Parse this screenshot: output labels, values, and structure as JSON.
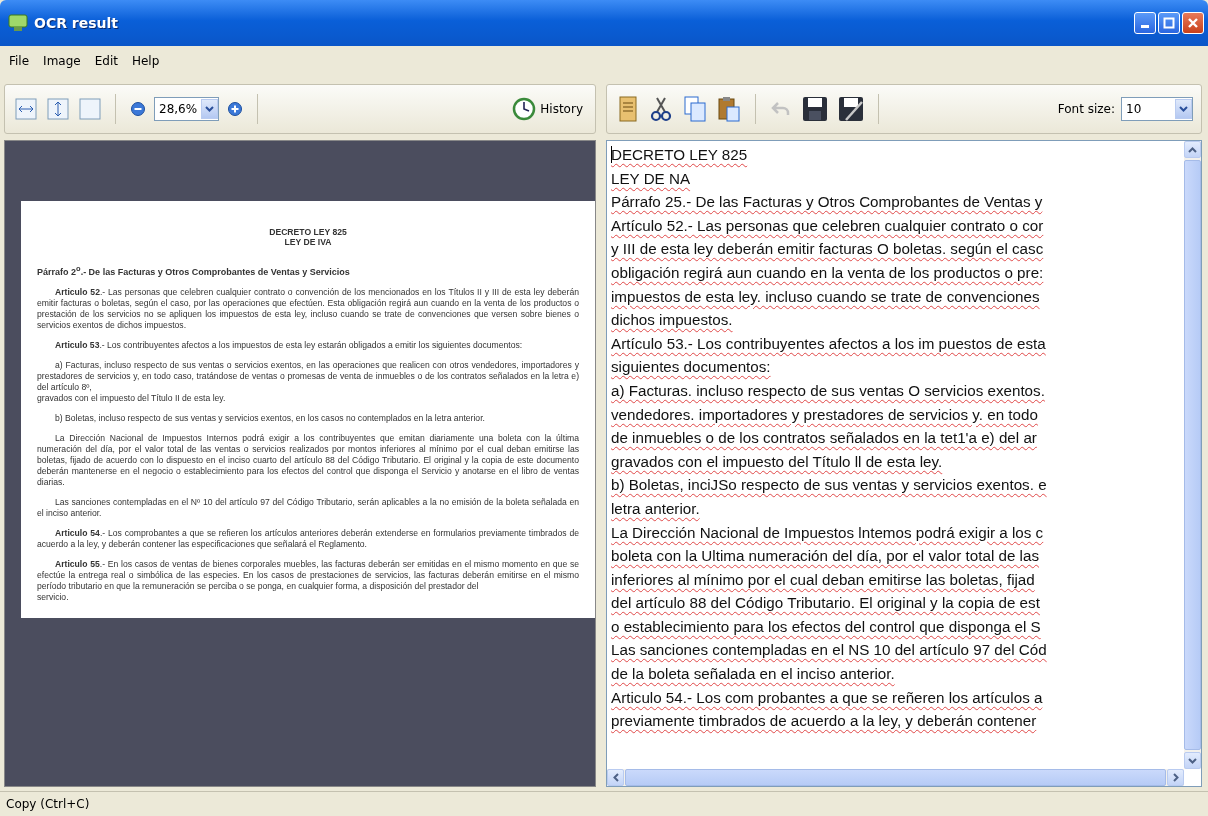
{
  "window": {
    "title": "OCR result"
  },
  "menu": [
    "File",
    "Image",
    "Edit",
    "Help"
  ],
  "image_toolbar": {
    "zoom": "28,6%",
    "history": "History"
  },
  "document": {
    "title_lines": [
      "DECRETO LEY 825",
      "LEY DE IVA"
    ],
    "heading": "Párrafo 2$^{o}$.- De las Facturas y Otros Comprobantes de Ventas y Servicios",
    "paragraphs": [
      {
        "kind": "para",
        "text": "**Articulo 52**.- Las personas que celebren cualquier contrato o convención de los mencionados en los Títulos II y III de esta ley deberán emitir facturas o boletas, según el caso, por las operaciones que efectúen. Esta obligación regirá aun cuando en la venta de los productos o prestación de los servicios no se apliquen los impuestos de esta ley, incluso cuando se trate de convenciones que versen sobre bienes o servicios exentos de dichos impuestos."
      },
      {
        "kind": "para",
        "text": "**Articulo 53**.- Los contribuyentes afectos a los impuestos de esta ley estarán obligados a emitir los siguientes documentos:"
      },
      {
        "kind": "para",
        "text": "a) Facturas, incluso respecto de sus ventas o servicios exentos, en las operaciones que realicen con otros vendedores, importadores y prestadores de servicios y, en todo caso, tratándose de ventas o promesas de venta de inmuebles o de los contratos señalados en la letra e) del artículo 8º,"
      },
      {
        "kind": "continuation",
        "text": "gravados con el impuesto del Título II de esta ley."
      },
      {
        "kind": "para",
        "text": "b) Boletas, incluso respecto de sus ventas y servicios exentos, en los casos no contemplados en la letra anterior."
      },
      {
        "kind": "para",
        "text": "La Dirección Nacional de Impuestos Internos podrá exigir a los contribuyentes que emitan diariamente una boleta con la última numeración del día, por el valor total de las ventas o servicios realizados por montos inferiores al mínimo por el cual deban emitirse las boletas, fijado de acuerdo con lo dispuesto en el inciso cuarto del artículo 88 del Código Tributario. El original y la copia de este documento deberán mantenerse en el negocio o establecimiento para los efectos del control que disponga el Servicio y anotarse en el libro de ventas diarias."
      },
      {
        "kind": "para",
        "text": "Las sanciones contempladas en el Nº 10 del artículo 97 del Código Tributario, serán aplicables a la no emisión de la boleta señalada en el inciso anterior."
      },
      {
        "kind": "para",
        "text": "**Articulo 54**.- Los comprobantes a que se refieren los artículos anteriores deberán extenderse en formularios previamente timbrados de acuerdo a la ley, y deberán contener las especificaciones que señalará el Reglamento."
      },
      {
        "kind": "para",
        "text": "**Articulo 55**.- En los casos de ventas de bienes corporales muebles, las facturas deberán ser emitidas en el mismo momento en que se efectúe la entrega real o simbólica de las especies. En los casos de prestaciones de servicios, las facturas deberán emitirse en el mismo período tributario en que la remuneración se perciba o se ponga, en cualquier forma, a disposición del prestador del"
      },
      {
        "kind": "continuation",
        "text": "servicio."
      }
    ]
  },
  "text_toolbar": {
    "undo_disabled": true,
    "font_size_label": "Font size:",
    "font_size": "10"
  },
  "editor": {
    "lines": [
      "DECRETO LEY 825",
      "LEY DE NA",
      "Párrafo 25.- De las Facturas y Otros Comprobantes de Ventas y",
      "Artículo 52.- Las personas que celebren cualquier contrato o cor",
      "y III de esta ley deberán emitir facturas O boletas. según el casc",
      "obligación regirá aun cuando en la venta de los productos o pre:",
      "impuestos de esta ley. incluso cuando se trate de convenciones",
      "dichos impuestos.",
      "Artículo 53.- Los contribuyentes afectos a los im puestos de esta",
      "siguientes documentos:",
      "a) Facturas. incluso respecto de sus ventas O servicios exentos.",
      "vendedores. importadores y prestadores de servicios y. en todo",
      "de inmuebles o de los contratos señalados en la tet1'a e) del ar",
      "gravados con el impuesto del Título ll de esta ley.",
      "b) Boletas, inciJSo respecto de sus ventas y servicios exentos. e",
      "letra anterior.",
      "La Dirección Nacional de Impuestos lntemos podrá exigir a los c",
      "boleta con la Ultima numeración del día, por el valor total de las",
      "inferiores al mínimo por el cual deban emitirse las boletas, fijad",
      "del artículo 88 del Código Tributario. El original y la copia de est",
      "o establecimiento para los efectos del control que disponga el S",
      "Las sanciones contempladas en el NS 10 del artículo 97 del Cód",
      "de la boleta señalada en el inciso anterior.",
      "Articulo 54.- Los com probantes a que se reñeren los artículos a",
      "previamente timbrados de acuerdo a la ley, y deberán contener"
    ]
  },
  "status_bar": "Copy (Ctrl+C)"
}
